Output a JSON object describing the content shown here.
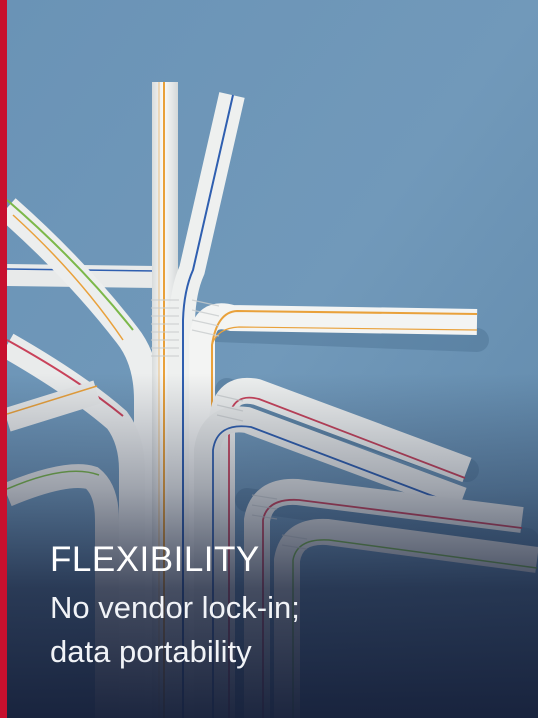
{
  "card": {
    "title": "FLEXIBILITY",
    "subtitle_line1": "No vendor lock-in;",
    "subtitle_line2": "data portability",
    "image": "bendy-straws-photo"
  },
  "colors": {
    "accent": "#c8102e",
    "background_blue": "#6f97b8",
    "overlay_navy": "#16203a",
    "straw_white": "#eef0ef",
    "stripe_orange": "#e9a13b",
    "stripe_blue": "#2f5fb0",
    "stripe_green": "#7cb84a",
    "stripe_red": "#c9425a"
  }
}
